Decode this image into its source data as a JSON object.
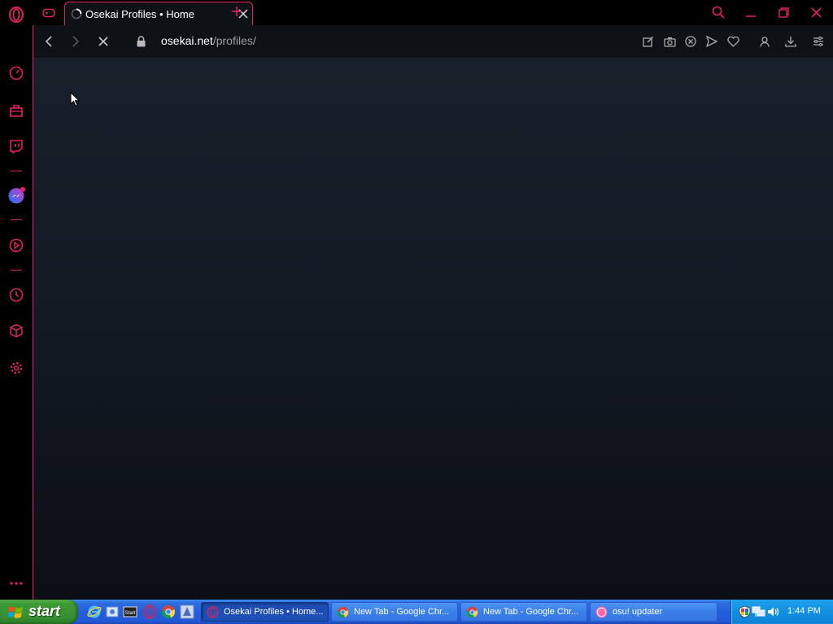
{
  "browser": {
    "tab_title": "Osekai Profiles • Home",
    "url_domain": "osekai.net",
    "url_path": "/profiles/"
  },
  "sidebar": {
    "icons": [
      "speed-dial-icon",
      "shopping-bag-icon",
      "twitch-icon",
      "messenger-icon",
      "player-icon",
      "history-icon",
      "extensions-icon",
      "settings-icon",
      "more-icon"
    ]
  },
  "colors": {
    "accent": "#e0245e",
    "page_bg_top": "#18202b",
    "page_bg_bottom": "#0b0f15",
    "taskbar": "#245edb",
    "start_green": "#388f31"
  },
  "taskbar": {
    "start_label": "start",
    "tasks": [
      {
        "label": "Osekai Profiles • Home..."
      },
      {
        "label": "New Tab - Google Chr..."
      },
      {
        "label": "New Tab - Google Chr..."
      },
      {
        "label": "osu! updater"
      }
    ],
    "clock": "1:44 PM"
  }
}
